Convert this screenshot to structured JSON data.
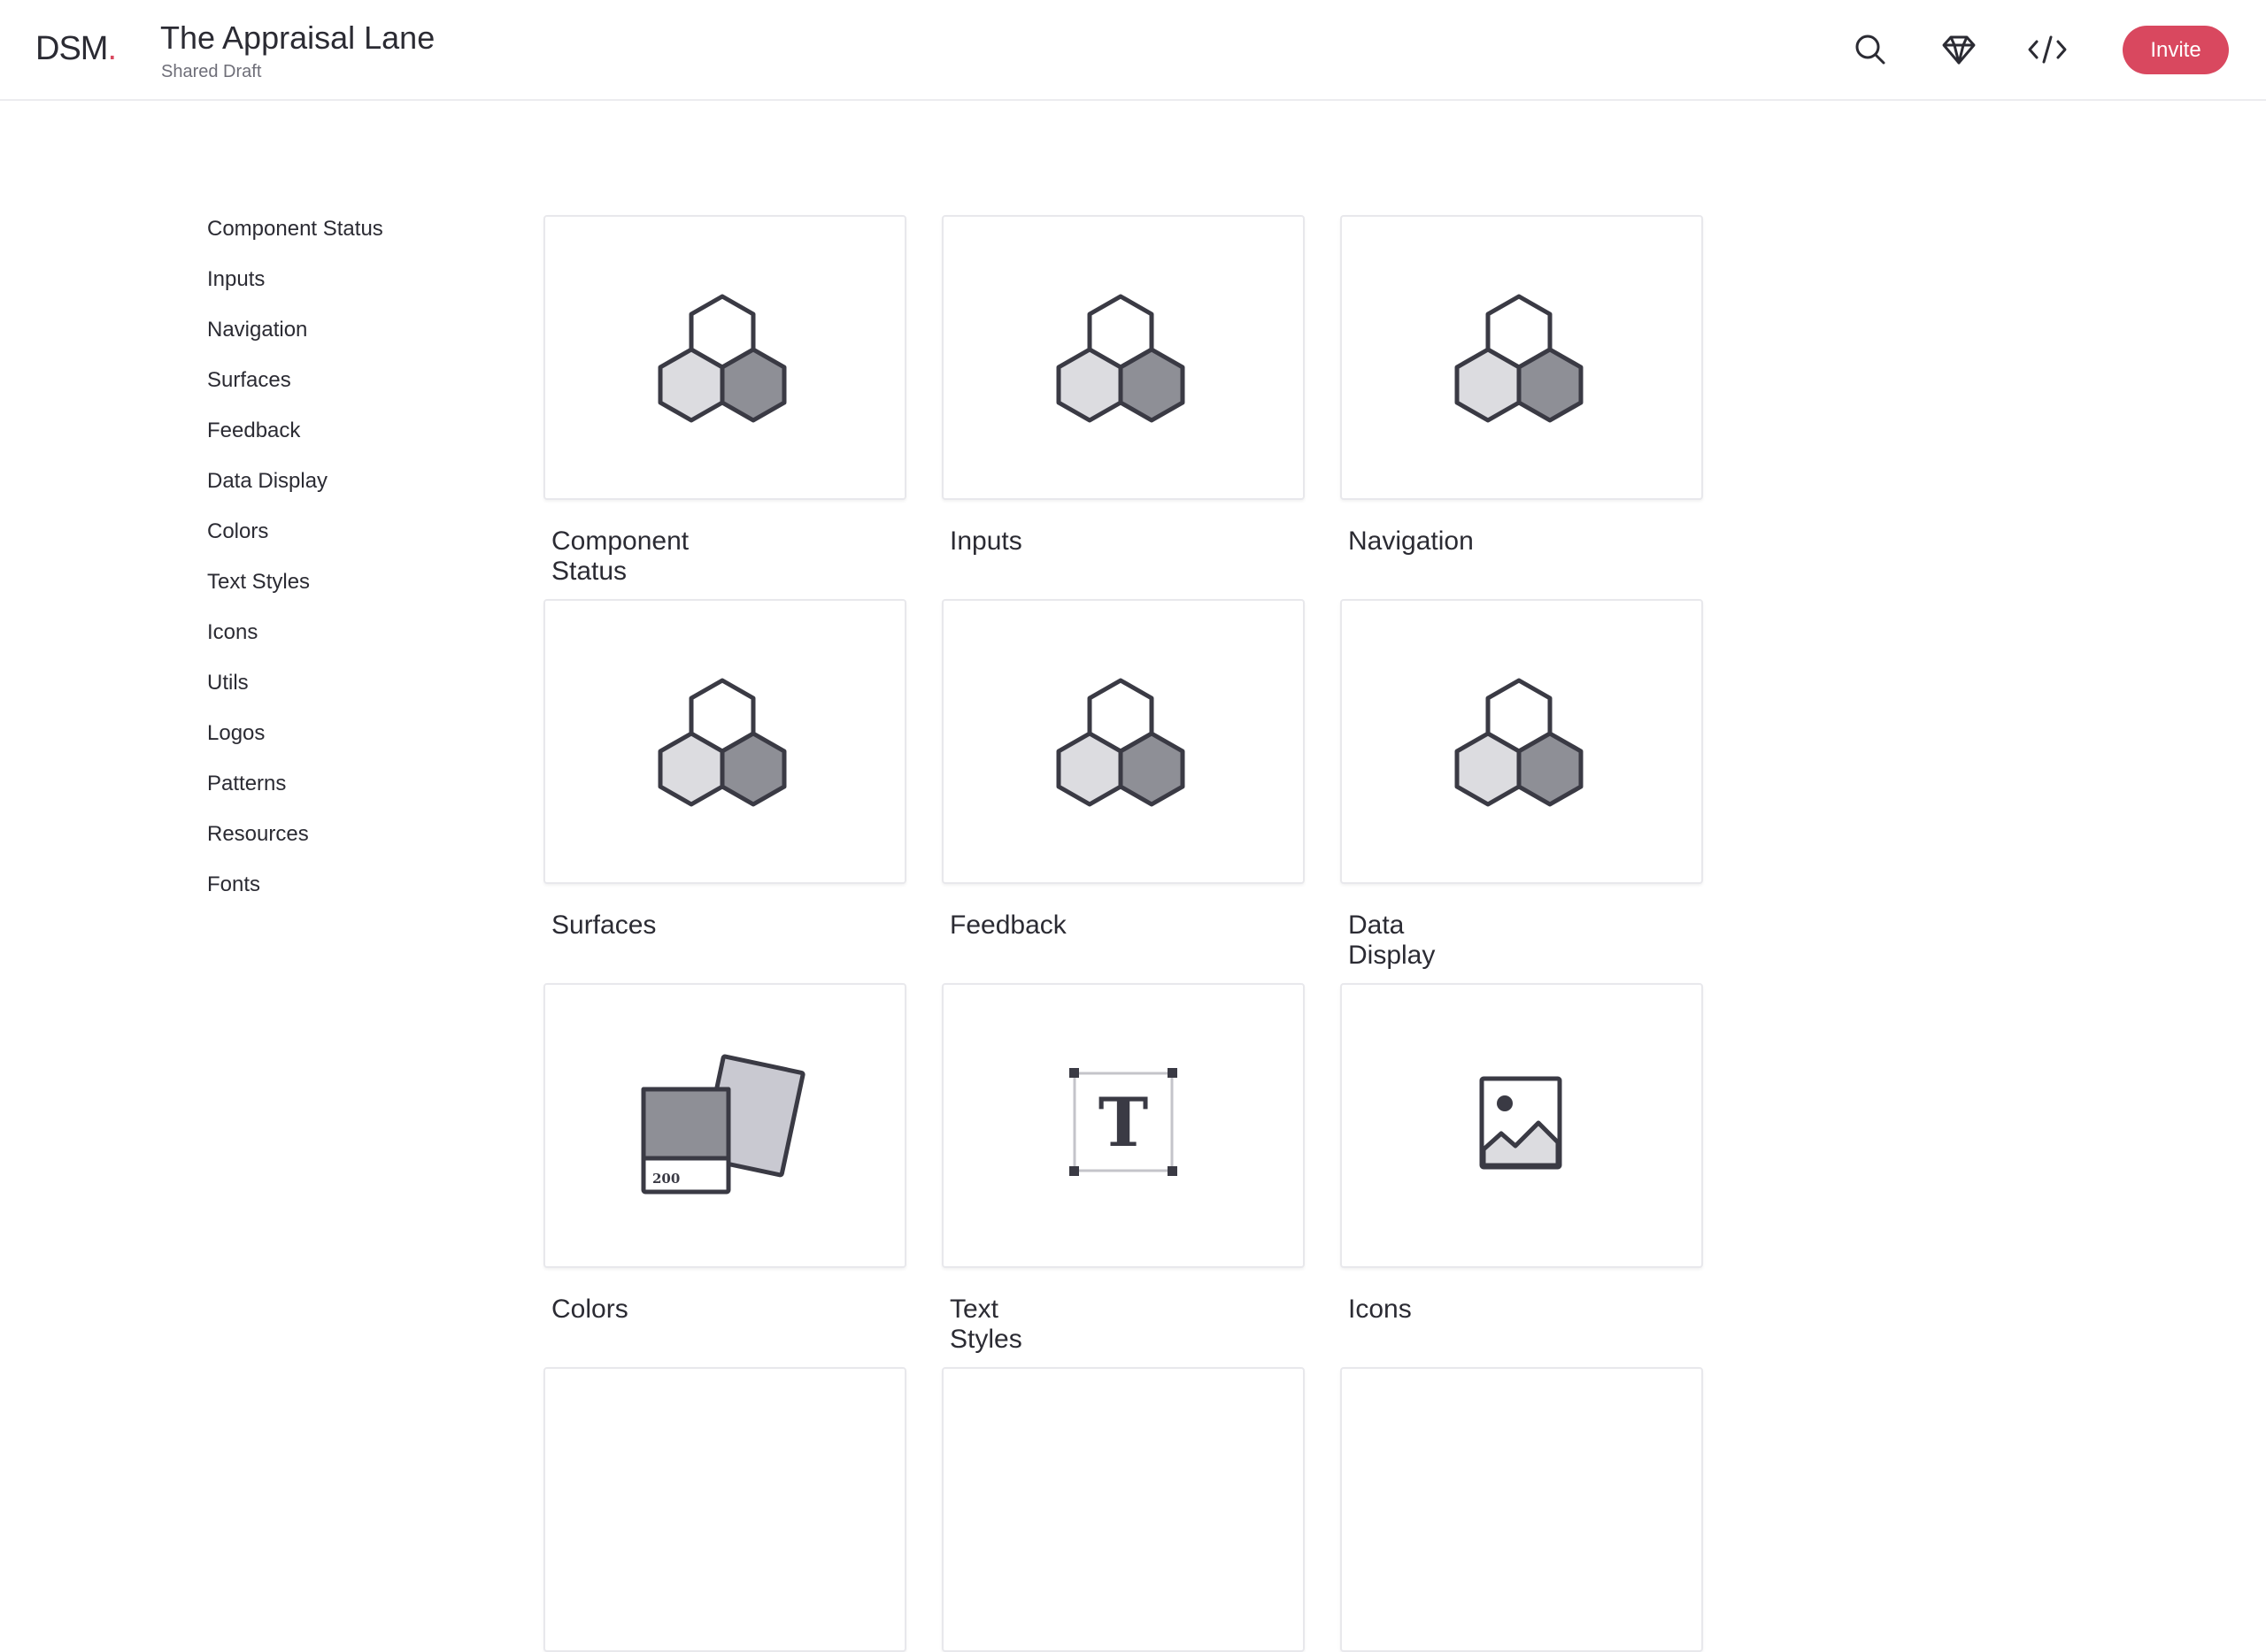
{
  "header": {
    "logo_text": "DSM",
    "logo_dot": ".",
    "title": "The Appraisal Lane",
    "subtitle": "Shared Draft",
    "invite_label": "Invite",
    "icons": [
      "search-icon",
      "sketch-icon",
      "code-icon"
    ]
  },
  "sidebar": {
    "items": [
      {
        "label": "Component Status"
      },
      {
        "label": "Inputs"
      },
      {
        "label": "Navigation"
      },
      {
        "label": "Surfaces"
      },
      {
        "label": "Feedback"
      },
      {
        "label": "Data Display"
      },
      {
        "label": "Colors"
      },
      {
        "label": "Text Styles"
      },
      {
        "label": "Icons"
      },
      {
        "label": "Utils"
      },
      {
        "label": "Logos"
      },
      {
        "label": "Patterns"
      },
      {
        "label": "Resources"
      },
      {
        "label": "Fonts"
      }
    ]
  },
  "cards": [
    {
      "label": "Component Status",
      "icon": "hexagon-cluster-icon"
    },
    {
      "label": "Inputs",
      "icon": "hexagon-cluster-icon"
    },
    {
      "label": "Navigation",
      "icon": "hexagon-cluster-icon"
    },
    {
      "label": "Surfaces",
      "icon": "hexagon-cluster-icon"
    },
    {
      "label": "Feedback",
      "icon": "hexagon-cluster-icon"
    },
    {
      "label": "Data Display",
      "icon": "hexagon-cluster-icon"
    },
    {
      "label": "Colors",
      "icon": "color-swatch-icon",
      "swatch_text": "200"
    },
    {
      "label": "Text Styles",
      "icon": "text-style-icon",
      "glyph": "T"
    },
    {
      "label": "Icons",
      "icon": "image-icon"
    }
  ],
  "colors": {
    "accent": "#d9485f",
    "icon_stroke": "#3a3a44",
    "hex_light": "#dcdce0",
    "hex_dark": "#8e8f96"
  }
}
